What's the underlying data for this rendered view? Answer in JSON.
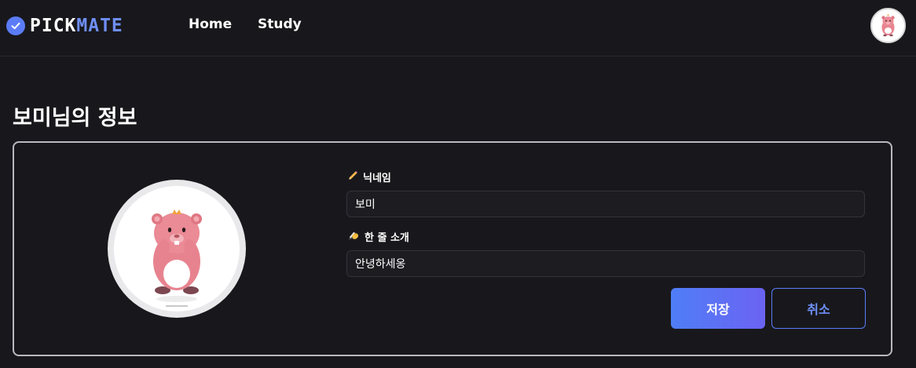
{
  "header": {
    "logo_part1": "PICK",
    "logo_part2": "MATE",
    "nav": [
      {
        "label": "Home"
      },
      {
        "label": "Study"
      }
    ]
  },
  "page": {
    "title": "보미님의 정보"
  },
  "form": {
    "nickname_label": "닉네임",
    "nickname_icon": "pencil-icon",
    "nickname_value": "보미",
    "intro_label": "한 줄 소개",
    "intro_icon": "writing-hand-icon",
    "intro_value": "안녕하세옹",
    "save_label": "저장",
    "cancel_label": "취소"
  },
  "colors": {
    "background": "#18181c",
    "accent": "#5b7cf7",
    "accent_text": "#6f8ff7"
  }
}
